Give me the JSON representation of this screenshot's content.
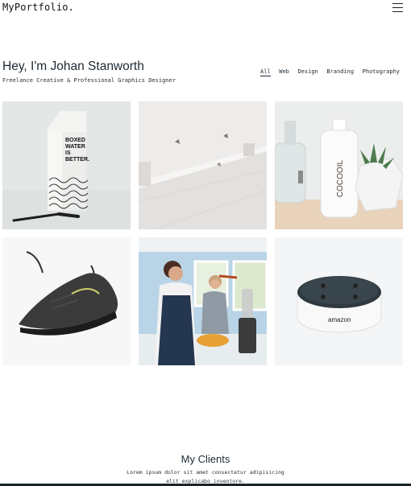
{
  "header": {
    "brand": "MyPortfolio."
  },
  "hero": {
    "title": "Hey, I'm Johan Stanworth",
    "subtitle": "Freelance Creative & Professional Graphics Designer"
  },
  "filters": [
    "All",
    "Web",
    "Design",
    "Branding",
    "Photography"
  ],
  "active_filter": "All",
  "portfolio": {
    "items": [
      {
        "image": "boxed-water-carton",
        "text": [
          "BOXED",
          "WATER",
          "IS",
          "BETTER."
        ]
      },
      {
        "image": "white-wall-architecture"
      },
      {
        "image": "cocooil-bottle-and-succulent",
        "text": "COCOOIL"
      },
      {
        "image": "nike-running-shoe"
      },
      {
        "image": "mother-and-son-cooking"
      },
      {
        "image": "amazon-echo-dot",
        "text": "amazon"
      }
    ]
  },
  "clients": {
    "title": "My Clients",
    "text": "Lorem ipsum dolor sit amet consectetur adipisicing elit explicabo inventore."
  }
}
